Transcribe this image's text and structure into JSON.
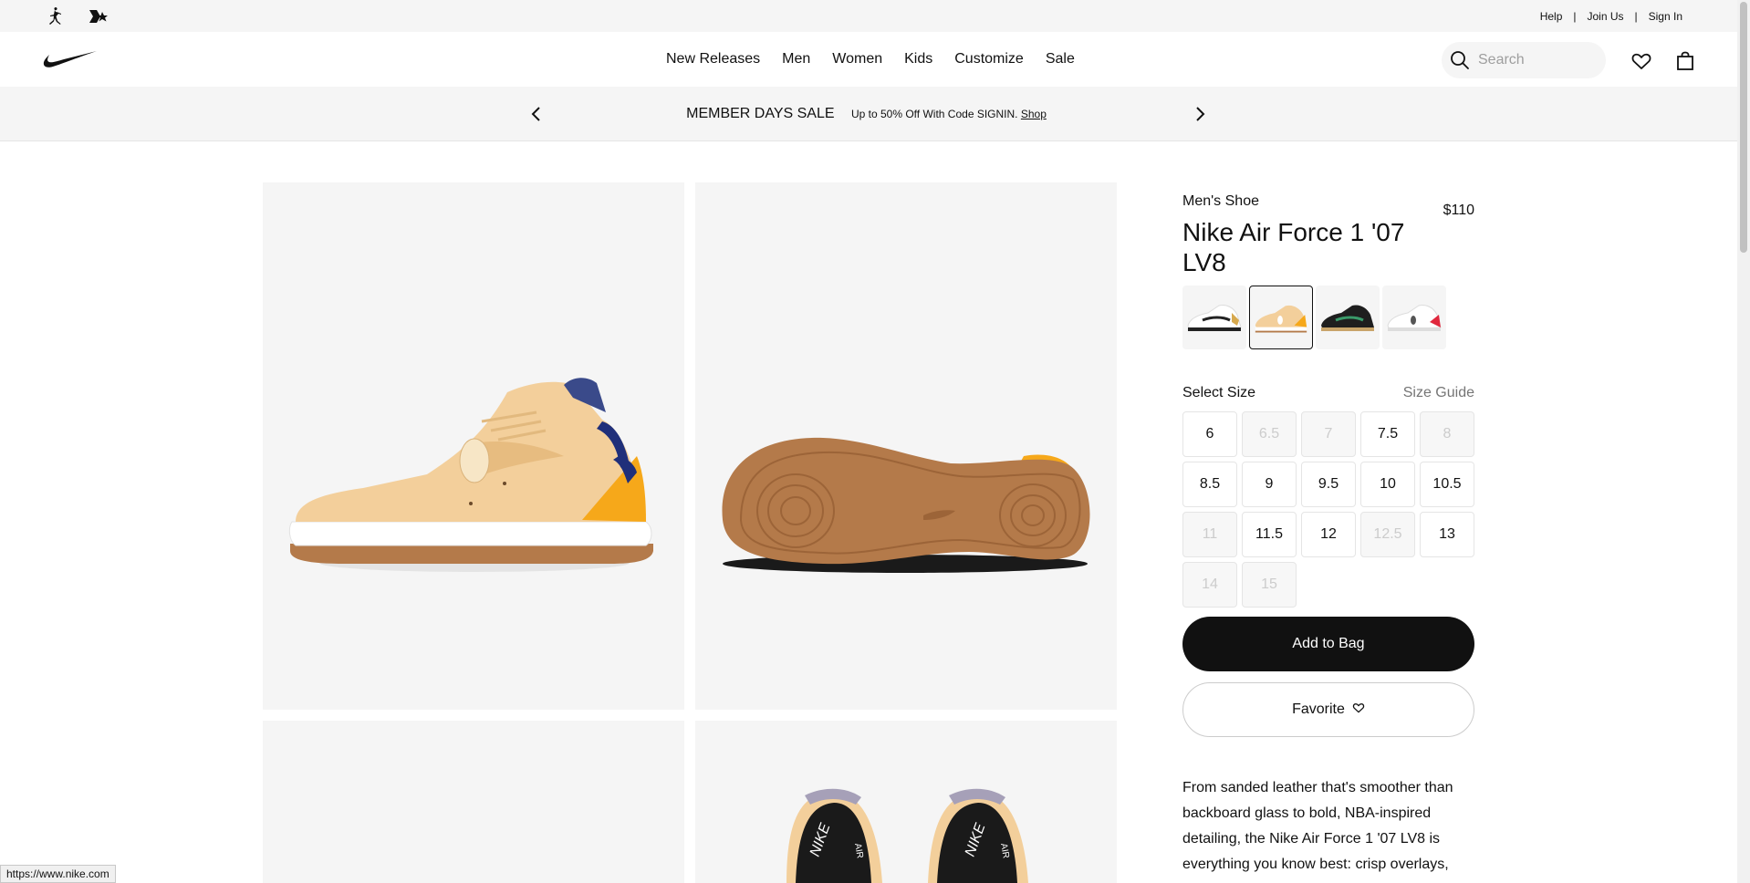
{
  "utility": {
    "links": [
      "Help",
      "Join Us",
      "Sign In"
    ]
  },
  "nav": {
    "menu": [
      "New Releases",
      "Men",
      "Women",
      "Kids",
      "Customize",
      "Sale"
    ],
    "search_placeholder": "Search"
  },
  "promo": {
    "title": "MEMBER DAYS SALE",
    "subtitle": "Up to 50% Off With Code SIGNIN.",
    "link": "Shop"
  },
  "product": {
    "category": "Men's Shoe",
    "price": "$110",
    "name": "Nike Air Force 1 '07 LV8",
    "colorways": [
      {
        "name": "white-black-gold",
        "accent": "#222222",
        "selected": false
      },
      {
        "name": "tan-gold",
        "accent": "#f3a81c",
        "selected": true
      },
      {
        "name": "black-gum",
        "accent": "#c8a46a",
        "selected": false
      },
      {
        "name": "white-red",
        "accent": "#e0283d",
        "selected": false
      }
    ],
    "select_size_label": "Select Size",
    "size_guide_label": "Size Guide",
    "sizes": [
      {
        "label": "6",
        "available": true
      },
      {
        "label": "6.5",
        "available": false
      },
      {
        "label": "7",
        "available": false
      },
      {
        "label": "7.5",
        "available": true
      },
      {
        "label": "8",
        "available": false
      },
      {
        "label": "8.5",
        "available": true
      },
      {
        "label": "9",
        "available": true
      },
      {
        "label": "9.5",
        "available": true
      },
      {
        "label": "10",
        "available": true
      },
      {
        "label": "10.5",
        "available": true
      },
      {
        "label": "11",
        "available": false
      },
      {
        "label": "11.5",
        "available": true
      },
      {
        "label": "12",
        "available": true
      },
      {
        "label": "12.5",
        "available": false
      },
      {
        "label": "13",
        "available": true
      },
      {
        "label": "14",
        "available": false
      },
      {
        "label": "15",
        "available": false
      }
    ],
    "add_to_bag": "Add to Bag",
    "favorite": "Favorite",
    "description": "From sanded leather that's smoother than backboard glass to bold, NBA-inspired detailing, the Nike Air Force 1 '07 LV8 is everything you know best: crisp overlays,"
  },
  "status_url": "https://www.nike.com",
  "colors": {
    "accent": "#111111",
    "tile_bg": "#f5f5f5",
    "shoe_tan": "#f3cf9b",
    "shoe_gold": "#f6a81a",
    "shoe_navy": "#1f2f7a",
    "gum": "#b47a4a"
  },
  "icons": [
    "jordan-icon",
    "converse-icon",
    "nike-swoosh-icon",
    "search-icon",
    "heart-icon",
    "bag-icon",
    "chevron-left-icon",
    "chevron-right-icon"
  ]
}
